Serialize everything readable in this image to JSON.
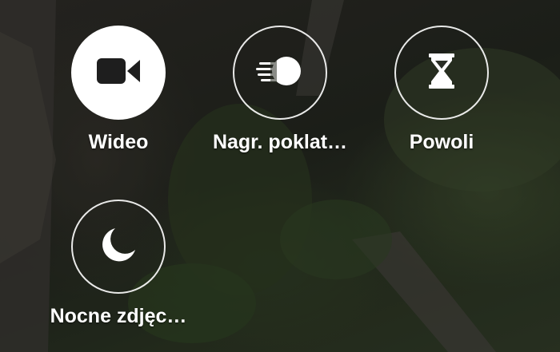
{
  "modes": [
    {
      "id": "video",
      "label": "Wideo",
      "icon": "video-camera-icon",
      "selected": true
    },
    {
      "id": "hyperlapse",
      "label": "Nagr. poklat…",
      "icon": "hyperlapse-icon",
      "selected": false
    },
    {
      "id": "slow-motion",
      "label": "Powoli",
      "icon": "hourglass-icon",
      "selected": false
    },
    {
      "id": "night",
      "label": "Nocne zdjęc…",
      "icon": "moon-icon",
      "selected": false
    }
  ],
  "colors": {
    "icon_on_selected": "#1e1e1e",
    "icon": "#ffffff",
    "ring": "#ffffff"
  }
}
